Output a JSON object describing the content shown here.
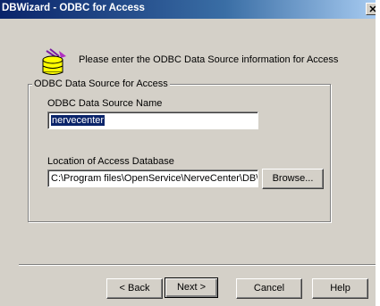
{
  "window": {
    "title": "DBWizard - ODBC for Access",
    "close_label": "✕"
  },
  "header": {
    "icon": "database-wizard-icon",
    "intro": "Please enter the ODBC Data Source information for Access"
  },
  "group": {
    "legend": "ODBC Data Source for Access",
    "dsn_label": "ODBC Data Source Name",
    "dsn_value": "nervecenter",
    "db_label": "Location of Access Database",
    "db_value": "C:\\Program files\\OpenService\\NerveCenter\\DB\\N",
    "browse_label": "Browse..."
  },
  "buttons": {
    "back": "< Back",
    "next": "Next >",
    "cancel": "Cancel",
    "help": "Help"
  }
}
